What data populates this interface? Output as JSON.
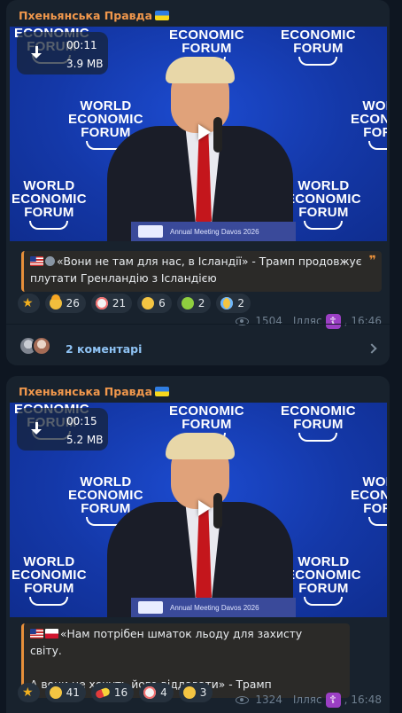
{
  "colors": {
    "background": "#0e1621",
    "bubble": "#18222d",
    "channel_name": "#f1984c",
    "quote_border": "#e68f3a",
    "link": "#8ec2f3",
    "meta": "#6f7f8f"
  },
  "posts": [
    {
      "channel": "Пхеньянська Правда",
      "video": {
        "duration": "00:11",
        "size": "3.9 MB",
        "overlay_text": {
          "wef_line1": "WORLD",
          "wef_line2": "ECONOMIC",
          "wef_line3": "FORUM",
          "podium": "Annual Meeting Davos 2026"
        }
      },
      "quote_lines": [
        "«Вони не там для нас, в Ісландії» - Трамп продовжує",
        "плутати Гренландію з Ісландією"
      ],
      "reactions": [
        {
          "icon": "star-icon",
          "count": ""
        },
        {
          "icon": "mind-blown-icon",
          "count": "26"
        },
        {
          "icon": "clown-icon",
          "count": "21"
        },
        {
          "icon": "grin-icon",
          "count": "6"
        },
        {
          "icon": "vomit-icon",
          "count": "2"
        },
        {
          "icon": "cry-icon",
          "count": "2"
        }
      ],
      "views": "1504",
      "author": "Ілляс",
      "time": "16:46",
      "comments": "2 коментарі"
    },
    {
      "channel": "Пхеньянська Правда",
      "video": {
        "duration": "00:15",
        "size": "5.2 MB",
        "overlay_text": {
          "wef_line1": "WORLD",
          "wef_line2": "ECONOMIC",
          "wef_line3": "FORUM",
          "podium": "Annual Meeting Davos 2026"
        }
      },
      "quote_lines": [
        "«Нам потрібен шматок льоду для захисту світу.",
        "",
        "А вони не хочуть його віддавати» - Трамп"
      ],
      "reactions": [
        {
          "icon": "star-icon",
          "count": ""
        },
        {
          "icon": "rofl-icon",
          "count": "41"
        },
        {
          "icon": "pill-icon",
          "count": "16"
        },
        {
          "icon": "clown-icon",
          "count": "4"
        },
        {
          "icon": "grin-icon",
          "count": "3"
        }
      ],
      "views": "1324",
      "author": "Ілляс",
      "time": "16:48"
    }
  ]
}
